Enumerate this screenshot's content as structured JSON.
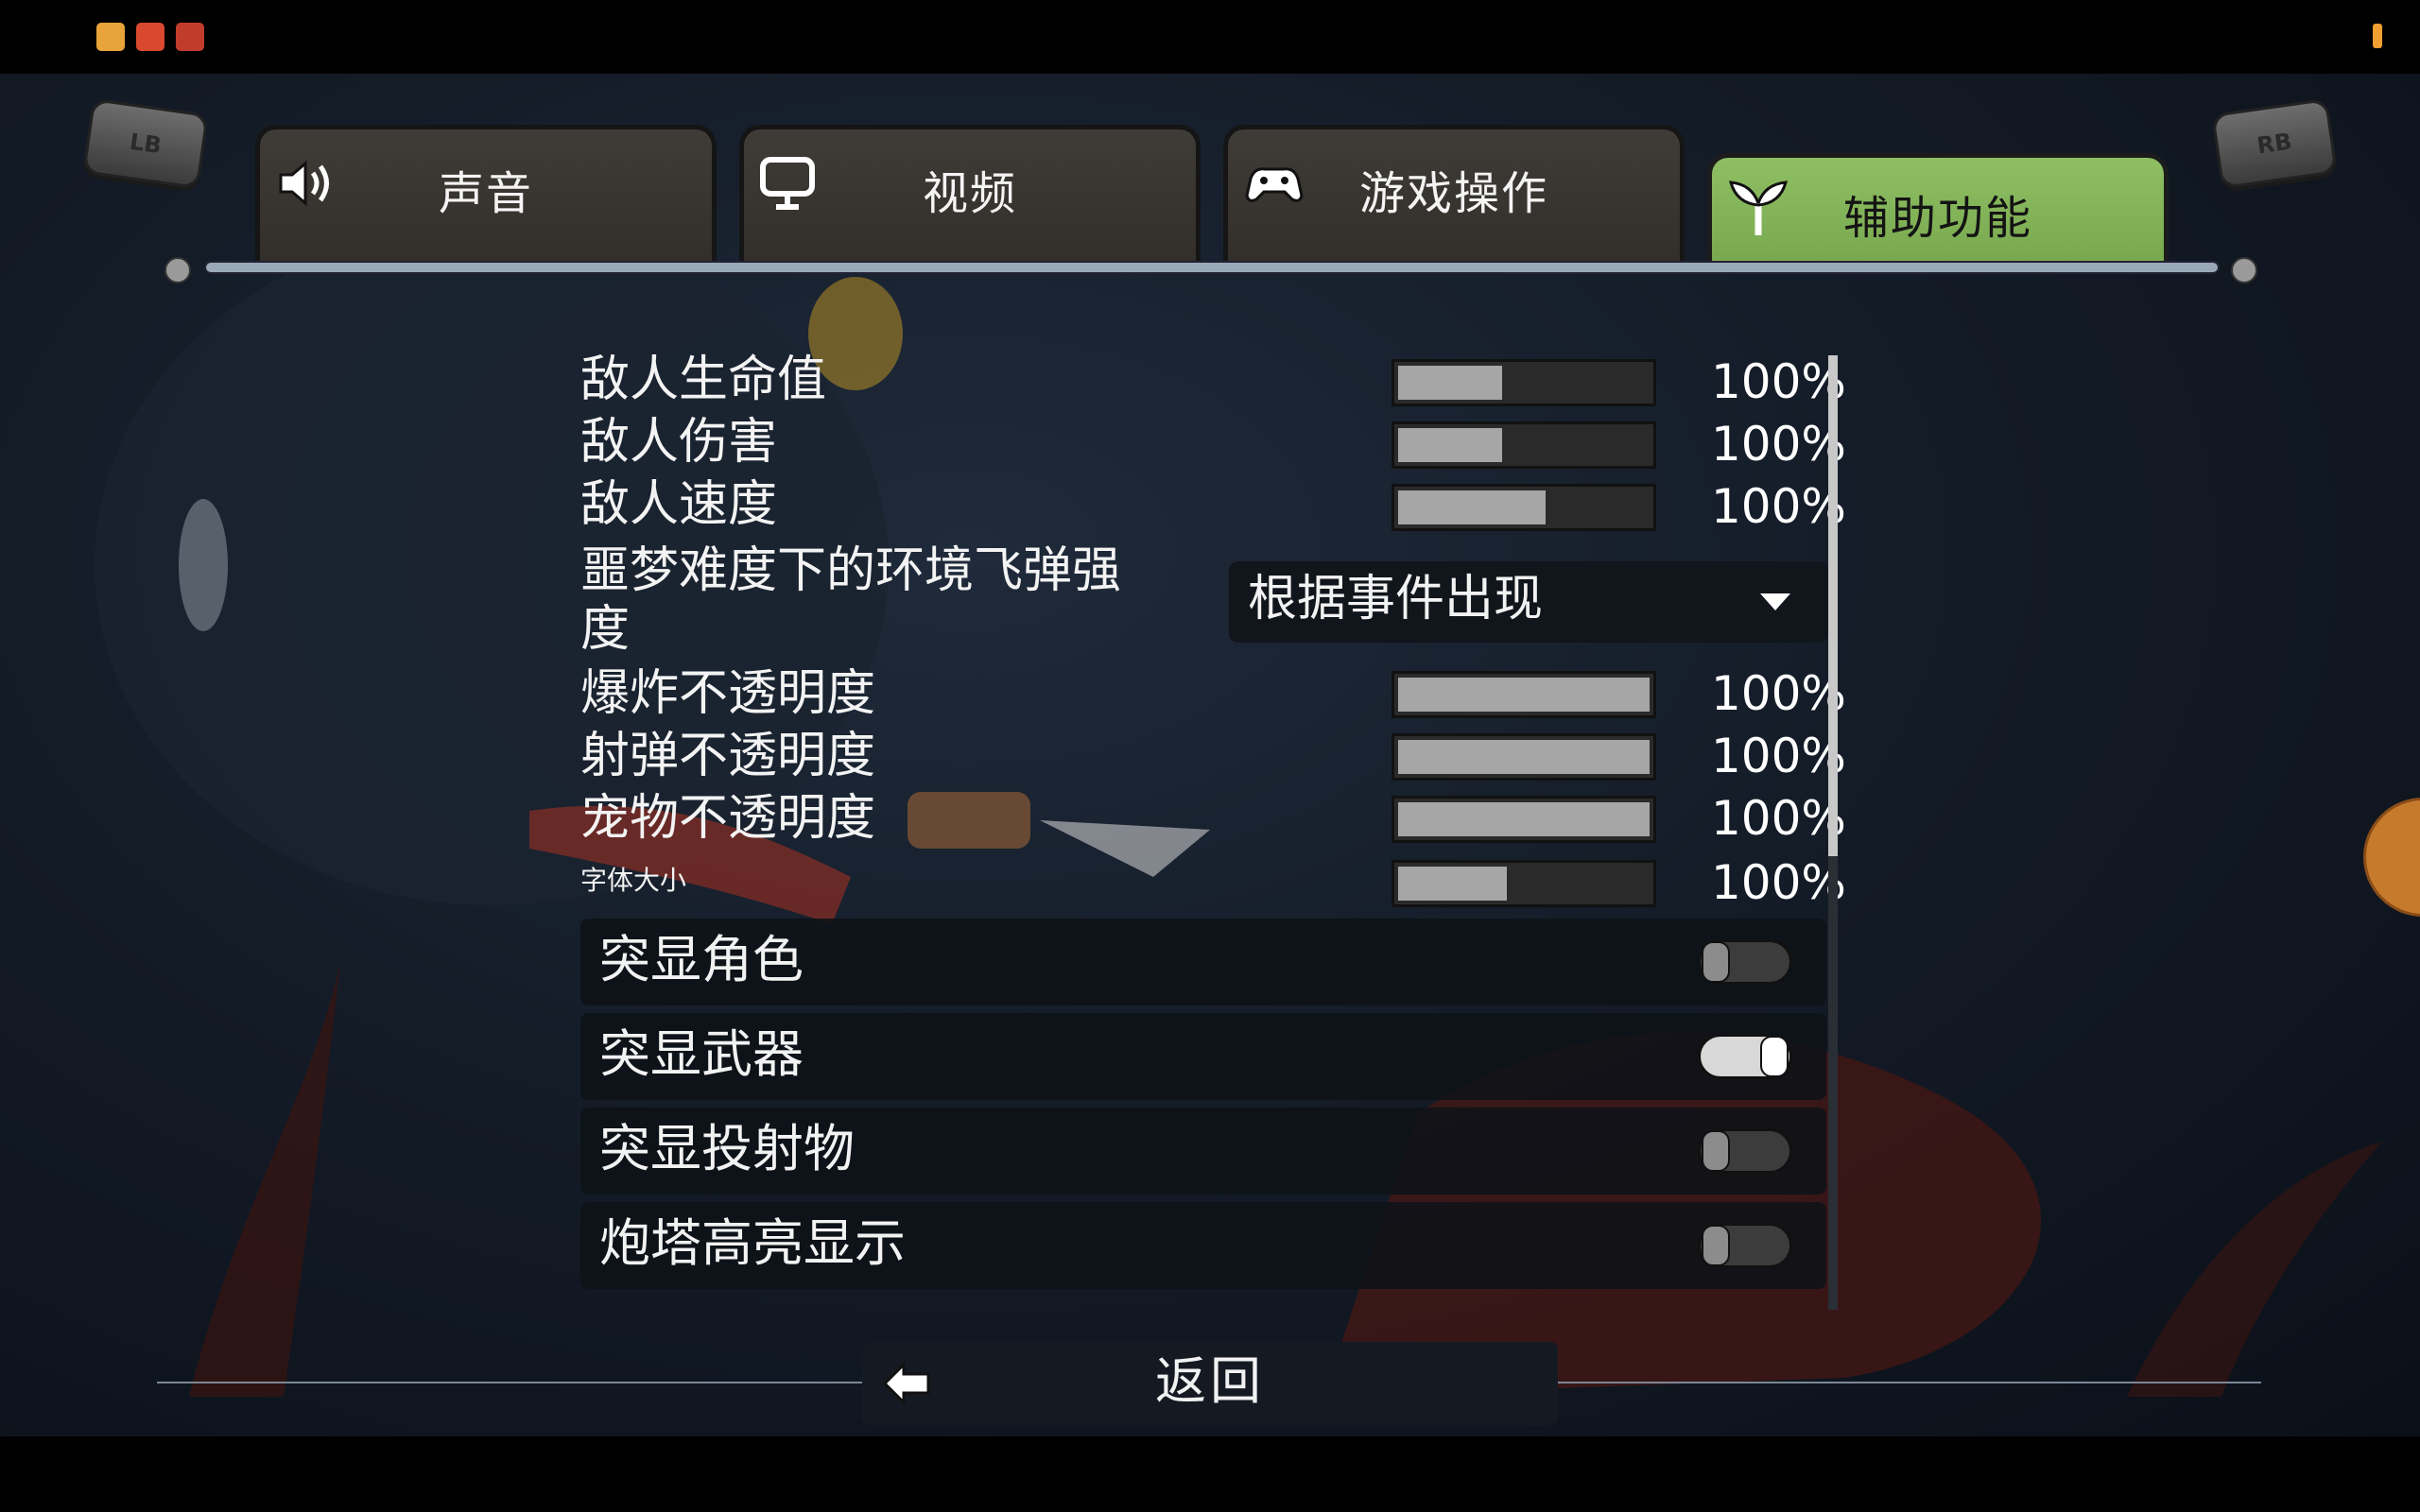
{
  "tabs": [
    {
      "label": "声音",
      "icon": "speaker-icon"
    },
    {
      "label": "视频",
      "icon": "monitor-icon"
    },
    {
      "label": "游戏操作",
      "icon": "gamepad-icon"
    },
    {
      "label": "辅助功能",
      "icon": "sprout-icon",
      "active": true
    }
  ],
  "shoulder_buttons": {
    "left": "LB",
    "right": "RB"
  },
  "sliders": [
    {
      "label": "敌人生命值",
      "value_text": "100%",
      "fill": 0.43
    },
    {
      "label": "敌人伤害",
      "value_text": "100%",
      "fill": 0.43
    },
    {
      "label": "敌人速度",
      "value_text": "100%",
      "fill": 0.6
    },
    {
      "label": "爆炸不透明度",
      "value_text": "100%",
      "fill": 1.0
    },
    {
      "label": "射弹不透明度",
      "value_text": "100%",
      "fill": 1.0
    },
    {
      "label": "宠物不透明度",
      "value_text": "100%",
      "fill": 1.0
    },
    {
      "label": "字体大小",
      "value_text": "100%",
      "fill": 0.45
    }
  ],
  "dropdown": {
    "label_line1": "噩梦难度下的环境飞弹强",
    "label_line2": "度",
    "value": "根据事件出现"
  },
  "toggles": [
    {
      "label": "突显角色",
      "on": false
    },
    {
      "label": "突显武器",
      "on": true
    },
    {
      "label": "突显投射物",
      "on": false
    },
    {
      "label": "炮塔高亮显示",
      "on": false
    }
  ],
  "back": {
    "label": "返回",
    "icon": "back-arrow-icon"
  },
  "colors": {
    "active_tab": "#84b45a",
    "tab": "#3a3732",
    "slider_fill": "#a6a6a6"
  }
}
